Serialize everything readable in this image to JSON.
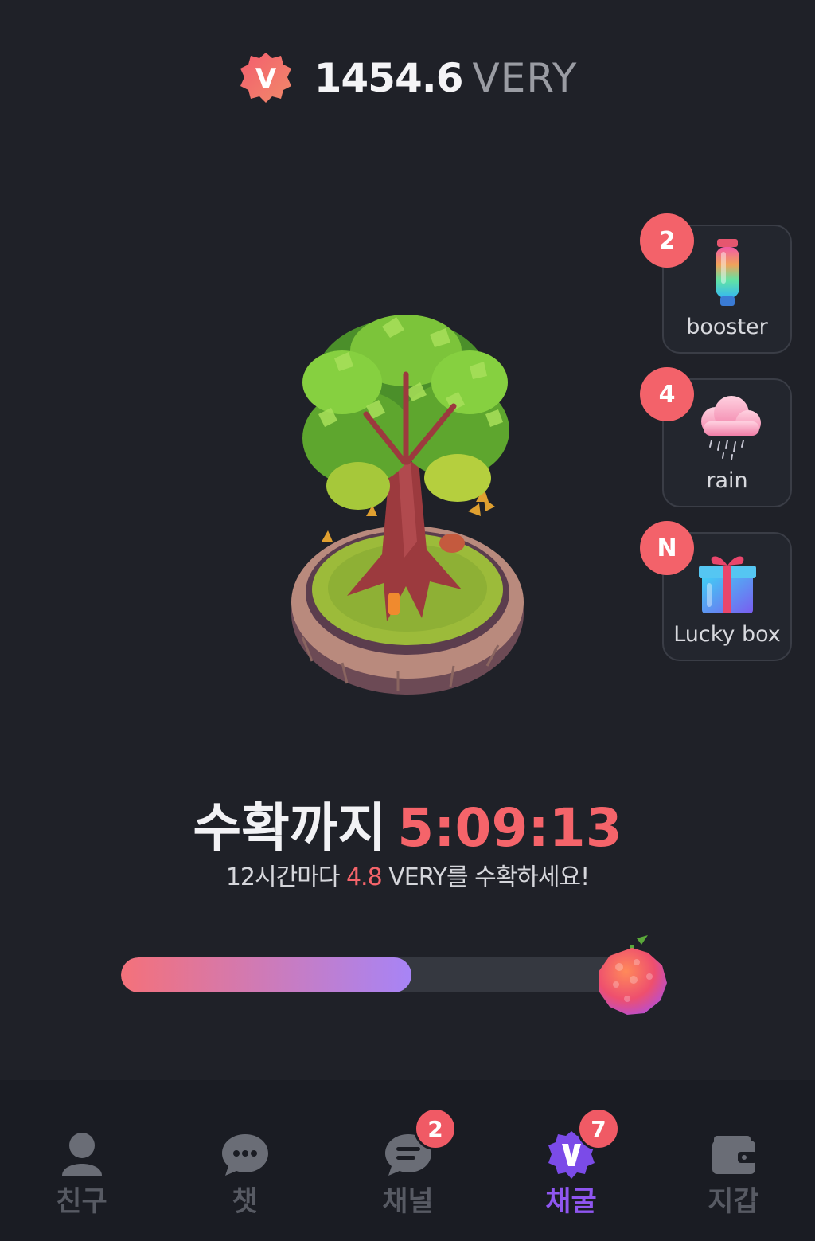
{
  "header": {
    "balance_amount": "1454.6",
    "balance_unit": "VERY",
    "badge_letter": "V"
  },
  "side_items": [
    {
      "label": "booster",
      "badge": "2",
      "icon": "booster-bottle-icon"
    },
    {
      "label": "rain",
      "badge": "4",
      "icon": "rain-cloud-icon"
    },
    {
      "label": "Lucky box",
      "badge": "N",
      "icon": "gift-box-icon"
    }
  ],
  "harvest": {
    "label": "수확까지",
    "timer": "5:09:13",
    "sub_prefix": "12시간마다",
    "sub_amount": "4.8",
    "sub_suffix": "VERY를 수확하세요!"
  },
  "progress": {
    "fraction": 0.57
  },
  "nav": {
    "items": [
      {
        "label": "친구",
        "icon": "friend-icon",
        "badge": null,
        "active": false
      },
      {
        "label": "챗",
        "icon": "chat-icon",
        "badge": null,
        "active": false
      },
      {
        "label": "채널",
        "icon": "channel-icon",
        "badge": "2",
        "active": false
      },
      {
        "label": "채굴",
        "icon": "mining-v-icon",
        "badge": "7",
        "active": true
      },
      {
        "label": "지갑",
        "icon": "wallet-icon",
        "badge": null,
        "active": false
      }
    ]
  },
  "colors": {
    "background": "#1f2128",
    "accent_red": "#f5646a",
    "accent_purple": "#8f56f0",
    "progress_start": "#f4717a",
    "progress_end": "#a784f6"
  }
}
